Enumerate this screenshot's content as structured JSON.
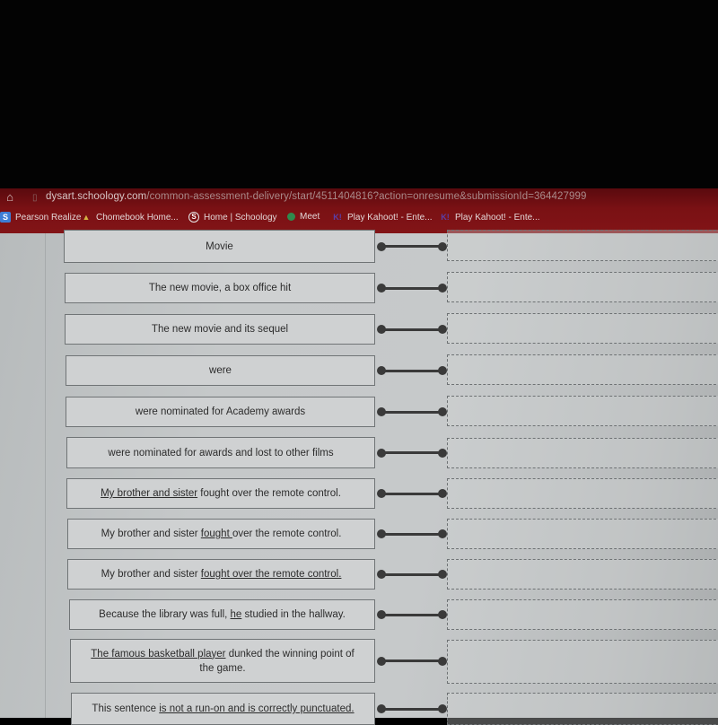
{
  "browser": {
    "url_host": "dysart.schoology.com",
    "url_path": "/common-assessment-delivery/start/4511404816?action=onresume&submissionId=364427999",
    "bookmarks": [
      {
        "label": "Pearson Realize",
        "icon": "pearson-realize-icon",
        "glyph": "S"
      },
      {
        "label": "Chomebook Home...",
        "icon": "chromebook-home-icon",
        "glyph": "▲"
      },
      {
        "label": "Home | Schoology",
        "icon": "schoology-icon",
        "glyph": "S"
      },
      {
        "label": "Meet",
        "icon": "google-meet-icon",
        "glyph": ""
      },
      {
        "label": "Play Kahoot! - Ente...",
        "icon": "kahoot-icon",
        "glyph": "K!"
      },
      {
        "label": "Play Kahoot! - Ente...",
        "icon": "kahoot-icon",
        "glyph": "K!"
      }
    ]
  },
  "matching": {
    "items": [
      {
        "segments": [
          {
            "text": "Movie",
            "u": false
          }
        ]
      },
      {
        "segments": [
          {
            "text": "The new movie, a box office hit",
            "u": false
          }
        ]
      },
      {
        "segments": [
          {
            "text": "The new movie and its sequel",
            "u": false
          }
        ]
      },
      {
        "segments": [
          {
            "text": "were",
            "u": false
          }
        ]
      },
      {
        "segments": [
          {
            "text": "were nominated for Academy awards",
            "u": false
          }
        ]
      },
      {
        "segments": [
          {
            "text": "were nominated for awards and lost to other films",
            "u": false
          }
        ]
      },
      {
        "segments": [
          {
            "text": "My brother and sister",
            "u": true
          },
          {
            "text": " fought over the remote control.",
            "u": false
          }
        ]
      },
      {
        "segments": [
          {
            "text": "My brother and sister ",
            "u": false
          },
          {
            "text": "fought ",
            "u": true
          },
          {
            "text": "over the remote control.",
            "u": false
          }
        ]
      },
      {
        "segments": [
          {
            "text": "My brother and sister ",
            "u": false
          },
          {
            "text": "fought over the remote control.",
            "u": true
          }
        ]
      },
      {
        "segments": [
          {
            "text": "Because the library was full, ",
            "u": false
          },
          {
            "text": "he",
            "u": true
          },
          {
            "text": " studied in the hallway.",
            "u": false
          }
        ]
      },
      {
        "segments": [
          {
            "text": "The famous basketball player",
            "u": true
          },
          {
            "text": " dunked the winning point of the game.",
            "u": false
          }
        ]
      },
      {
        "segments": [
          {
            "text": "This sentence ",
            "u": false
          },
          {
            "text": "is not a run-on and is correctly punctuated.",
            "u": true
          }
        ]
      }
    ],
    "drop_zones": [
      "",
      "",
      "",
      "",
      "",
      "",
      "",
      "",
      "",
      "",
      "",
      ""
    ]
  }
}
